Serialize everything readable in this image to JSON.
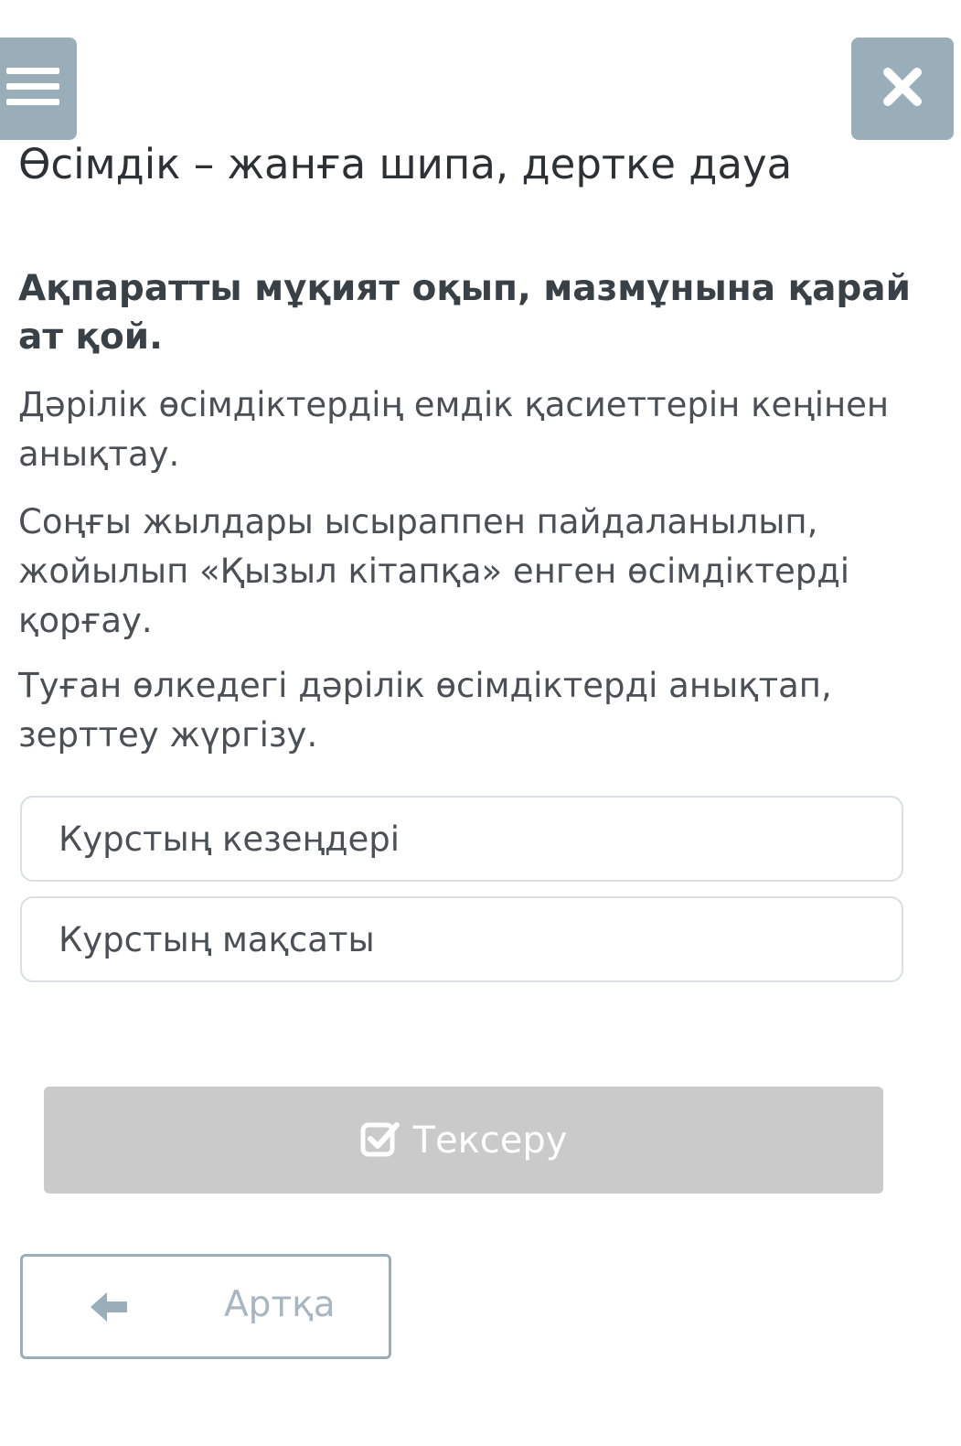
{
  "header": {
    "menu_icon": "hamburger-menu-icon",
    "close_icon": "close-icon",
    "accent_color": "#9aaeba"
  },
  "page": {
    "title": "Өсімдік – жанға шипа, дертке дауа",
    "instruction": "Ақпаратты мұқият оқып, мазмұнына қарай ат қой.",
    "paragraphs": [
      "Дәрілік өсімдіктердің емдік қасиеттерін кеңінен анықтау.",
      "Соңғы жылдары ысыраппен пайдаланылып, жойылып «Қызыл кітапқа» енген өсімдіктерді қорғау.",
      "Туған өлкедегі дәрілік өсімдіктерді анықтап, зерттеу жүргізу."
    ]
  },
  "options": [
    {
      "label": "Курстың кезеңдері"
    },
    {
      "label": "Курстың мақсаты"
    }
  ],
  "actions": {
    "check_label": "Тексеру",
    "check_icon": "checkbox-check-icon",
    "back_label": "Артқа",
    "back_icon": "arrow-left-icon"
  }
}
